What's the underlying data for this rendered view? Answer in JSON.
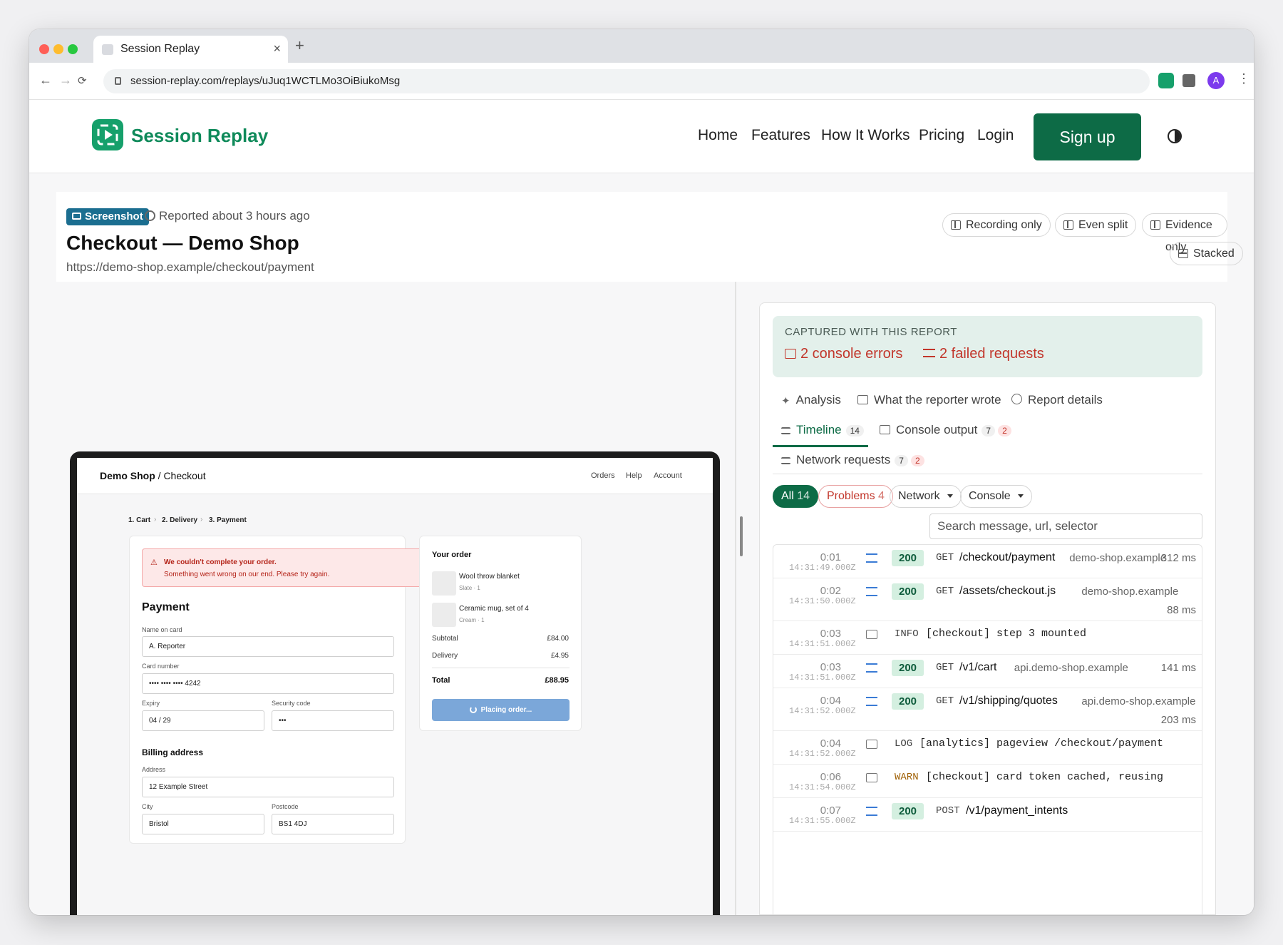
{
  "browser": {
    "tab_title": "Session Replay",
    "tab_close": "×",
    "new_tab": "+",
    "url": "session-replay.com/replays/uJuq1WCTLMo3OiBiukoMsg",
    "avatar_letter": "A",
    "nav": {
      "back": "←",
      "forward": "→",
      "reload": "⟳",
      "menu": "⋮"
    }
  },
  "site": {
    "brand": "Session Replay",
    "nav": [
      "Home",
      "Features",
      "How It Works",
      "Pricing",
      "Login"
    ],
    "signup": "Sign up",
    "accent": "#0d6b46"
  },
  "report": {
    "badge": "Screenshot",
    "reported": "Reported about 3 hours ago",
    "title": "Checkout — Demo Shop",
    "url": "https://demo-shop.example/checkout/payment",
    "modes": [
      "Recording only",
      "Even split",
      "Evidence only",
      "Stacked"
    ]
  },
  "shop": {
    "brand": "Demo Shop",
    "brand_suffix": " / Checkout",
    "nav": [
      "Orders",
      "Help",
      "Account"
    ],
    "steps": [
      "1. Cart",
      "2. Delivery",
      "3. Payment"
    ],
    "step_sep": "›",
    "alert_title": "We couldn't complete your order.",
    "alert_body": "Something went wrong on our end. Please try again.",
    "alert_icon": "⚠",
    "payment_heading": "Payment",
    "name_label": "Name on card",
    "name_value": "A. Reporter",
    "card_label": "Card number",
    "card_value": "•••• •••• •••• 4242",
    "expiry_label": "Expiry",
    "expiry_value": "04 / 29",
    "cvc_label": "Security code",
    "cvc_value": "•••",
    "billing_heading": "Billing address",
    "address_label": "Address",
    "address_value": "12 Example Street",
    "city_label": "City",
    "city_value": "Bristol",
    "postcode_label": "Postcode",
    "postcode_value": "BS1 4DJ",
    "order_title": "Your order",
    "items": [
      {
        "name": "Wool throw blanket",
        "sub": "Slate · 1"
      },
      {
        "name": "Ceramic mug, set of 4",
        "sub": "Cream · 1"
      }
    ],
    "subtotal_label": "Subtotal",
    "subtotal": "£84.00",
    "delivery_label": "Delivery",
    "delivery": "£4.95",
    "total_label": "Total",
    "total": "£88.95",
    "place_order": "Placing order..."
  },
  "panel": {
    "captured_title": "CAPTURED WITH THIS REPORT",
    "console_errors": "2 console errors",
    "failed_requests": "2 failed requests",
    "tabs_row1": [
      "Analysis",
      "What the reporter wrote",
      "Report details"
    ],
    "timeline": {
      "label": "Timeline",
      "count": "14"
    },
    "console": {
      "label": "Console output",
      "count": "7",
      "errors": "2"
    },
    "network": {
      "label": "Network requests",
      "count": "7",
      "errors": "2"
    },
    "filters": {
      "all": "All",
      "all_count": "14",
      "problems": "Problems",
      "problems_count": "4",
      "network": "Network",
      "console": "Console"
    },
    "search_placeholder": "Search message, url, selector",
    "events": [
      {
        "t": "0:01",
        "ts": "14:31:49.000Z",
        "kind": "net",
        "status": "200",
        "method": "GET",
        "path": "/checkout/payment",
        "host": "demo-shop.example",
        "dur": "312 ms"
      },
      {
        "t": "0:02",
        "ts": "14:31:50.000Z",
        "kind": "net",
        "status": "200",
        "method": "GET",
        "path": "/assets/checkout.js",
        "host": "demo-shop.example",
        "dur": "88 ms"
      },
      {
        "t": "0:03",
        "ts": "14:31:51.000Z",
        "kind": "con",
        "level": "INFO",
        "msg": "[checkout] step 3 mounted"
      },
      {
        "t": "0:03",
        "ts": "14:31:51.000Z",
        "kind": "net",
        "status": "200",
        "method": "GET",
        "path": "/v1/cart",
        "host": "api.demo-shop.example",
        "dur": "141 ms"
      },
      {
        "t": "0:04",
        "ts": "14:31:52.000Z",
        "kind": "net",
        "status": "200",
        "method": "GET",
        "path": "/v1/shipping/quotes",
        "host": "api.demo-shop.example",
        "dur": "203 ms"
      },
      {
        "t": "0:04",
        "ts": "14:31:52.000Z",
        "kind": "con",
        "level": "LOG",
        "msg": "[analytics] pageview /checkout/payment"
      },
      {
        "t": "0:06",
        "ts": "14:31:54.000Z",
        "kind": "con",
        "level": "WARN",
        "msg": "[checkout] card token cached, reusing"
      },
      {
        "t": "0:07",
        "ts": "14:31:55.000Z",
        "kind": "net",
        "status": "200",
        "method": "POST",
        "path": "/v1/payment_intents"
      }
    ]
  }
}
